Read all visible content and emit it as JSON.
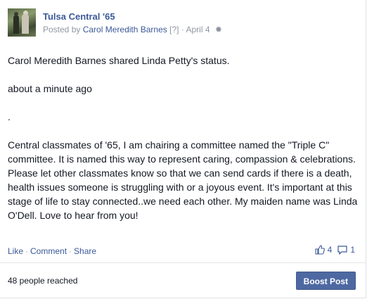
{
  "post": {
    "group_name": "Tulsa Central '65",
    "byline_prefix": "Posted by",
    "author": "Carol Meredith Barnes",
    "author_marker": "[?]",
    "date": "April 4",
    "shared_line": "Carol Meredith Barnes shared Linda Petty's status.",
    "timestamp": "about a minute ago",
    "dot": ".",
    "body": "Central classmates of '65, I am chairing a committee named the \"Triple C\" committee. It is named this way to represent caring, compassion & celebrations. Please let other classmates know so that we can send cards if there is a death, health issues someone is struggling with or a joyous event. It's important at this stage of life to stay connected..we need each other. My maiden name was Linda O'Dell. Love to hear from you!"
  },
  "actions": {
    "like": "Like",
    "comment": "Comment",
    "share": "Share",
    "separator": "·",
    "like_count": "4",
    "comment_count": "1"
  },
  "footer": {
    "reached": "48 people reached",
    "boost_label": "Boost Post"
  },
  "colors": {
    "link": "#3b5998",
    "muted": "#9197a3",
    "boost_bg": "#4e69a2"
  }
}
